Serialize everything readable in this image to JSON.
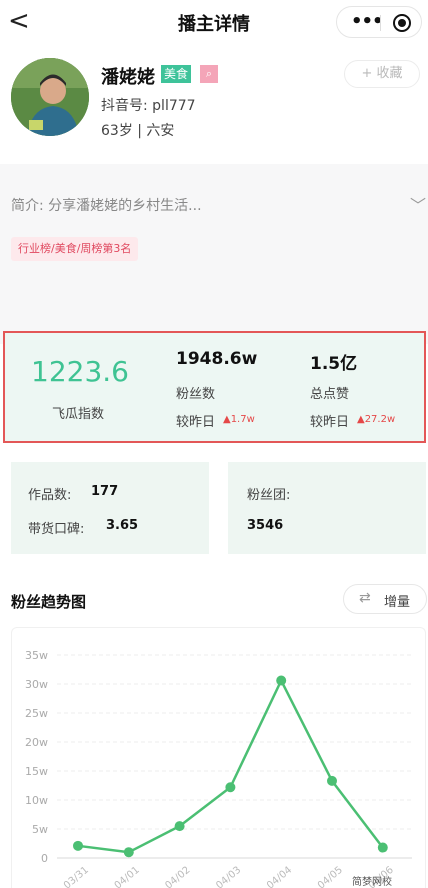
{
  "nav": {
    "back_glyph": "<",
    "title": "播主详情",
    "menu_icon": "more-dots-icon",
    "target_icon": "target-icon"
  },
  "profile": {
    "name": "潘姥姥",
    "category_tag": "美食",
    "search_tag_glyph": "⌕",
    "favorite_label": "+ 收藏",
    "douyin_id": "抖音号: pll777",
    "age_location": "63岁 | 六安",
    "intro": "简介: 分享潘姥姥的乡村生活...",
    "rank_tag": "行业榜/美食/周榜第3名"
  },
  "stats": {
    "index_value": "1223.6",
    "index_label": "飞瓜指数",
    "fans_value": "1948.6w",
    "fans_label": "粉丝数",
    "fans_change_label": "较昨日",
    "fans_change": "▲1.7w",
    "likes_value": "1.5亿",
    "likes_label": "总点赞",
    "likes_change_label": "较昨日",
    "likes_change": "▲27.2w"
  },
  "cards": {
    "works_label": "作品数:",
    "works_value": "177",
    "reputation_label": "带货口碑:",
    "reputation_value": "3.65",
    "fan_group_label": "粉丝团:",
    "fan_group_value": "3546"
  },
  "trend": {
    "title": "粉丝趋势图",
    "toggle_label": "增量"
  },
  "chart_data": {
    "type": "line",
    "title": "",
    "xlabel": "",
    "ylabel": "",
    "ylim": [
      0,
      35
    ],
    "y_ticks": [
      "0",
      "5w",
      "10w",
      "15w",
      "20w",
      "25w",
      "30w",
      "35w"
    ],
    "categories": [
      "03/31",
      "04/01",
      "04/02",
      "04/03",
      "04/04",
      "04/05",
      "04/06"
    ],
    "series": [
      {
        "values": [
          2.1,
          1.0,
          5.5,
          12.2,
          30.6,
          13.3,
          1.8
        ]
      }
    ],
    "line_color": "#4bbf73",
    "grid": true
  },
  "watermark": "简梦网校"
}
